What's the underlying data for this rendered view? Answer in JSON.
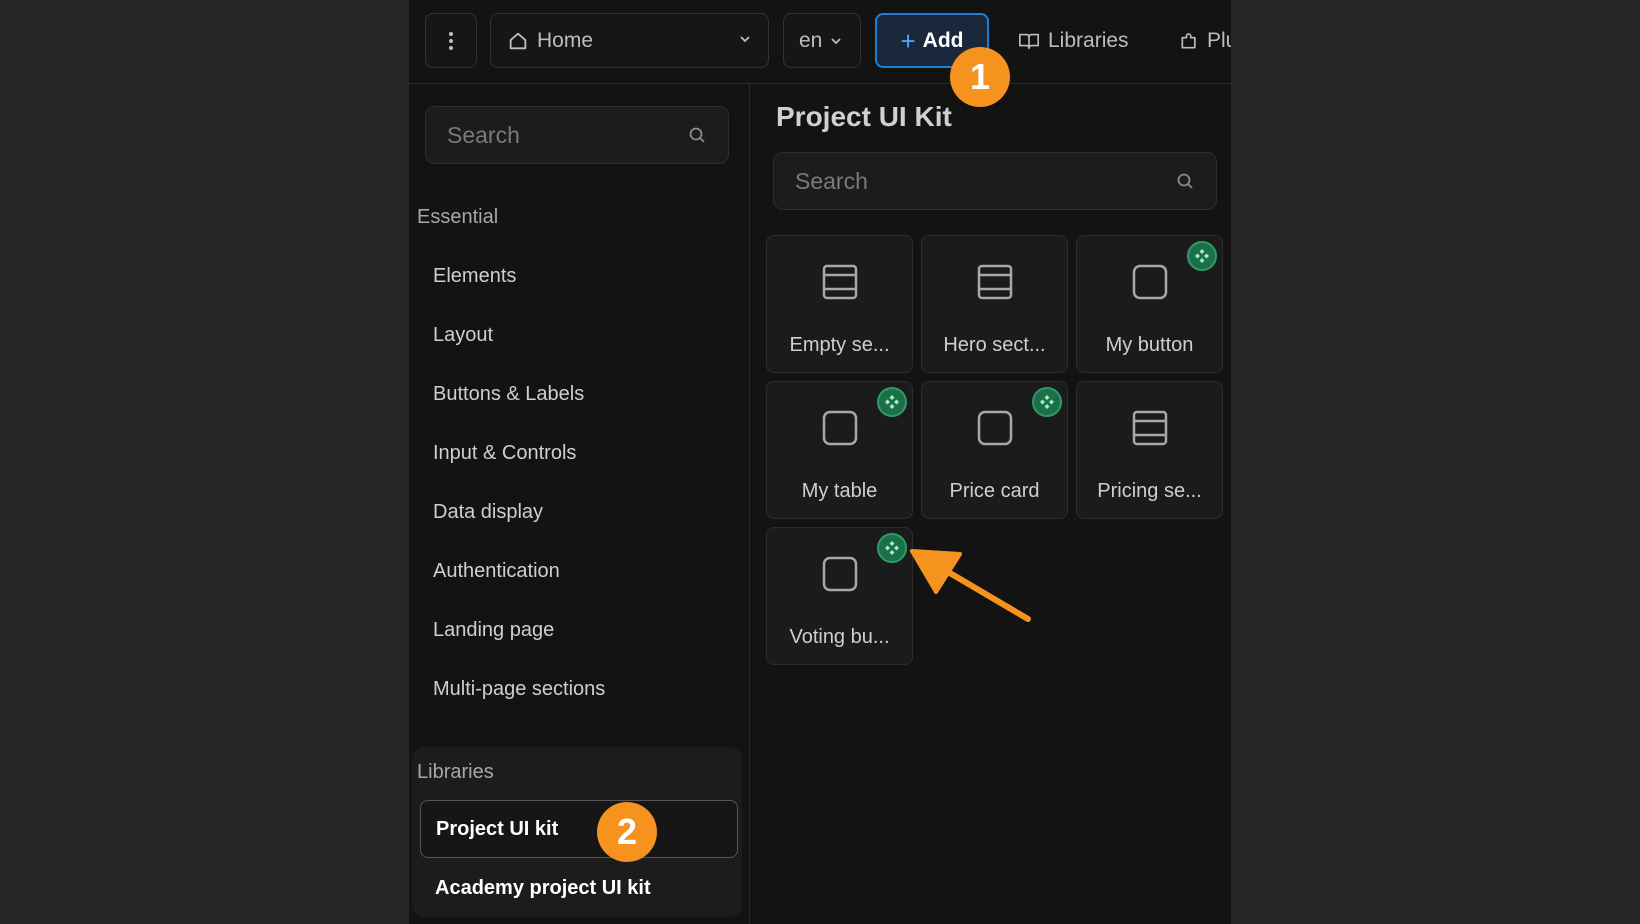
{
  "topbar": {
    "page_select": "Home",
    "language_select": "en",
    "add_label": "Add",
    "libraries_label": "Libraries",
    "plugins_label": "Plu"
  },
  "sidebar": {
    "search_placeholder": "Search",
    "essential_title": "Essential",
    "items": [
      {
        "label": "Elements"
      },
      {
        "label": "Layout"
      },
      {
        "label": "Buttons & Labels"
      },
      {
        "label": "Input & Controls"
      },
      {
        "label": "Data display"
      },
      {
        "label": "Authentication"
      },
      {
        "label": "Landing page"
      },
      {
        "label": "Multi-page sections"
      }
    ],
    "libraries_title": "Libraries",
    "libraries": [
      {
        "label": "Project UI kit",
        "active": true
      },
      {
        "label": "Academy project UI kit",
        "active": false
      }
    ]
  },
  "main": {
    "title": "Project UI Kit",
    "search_placeholder": "Search",
    "cards": [
      {
        "label": "Empty se...",
        "icon": "section-icon",
        "component": false
      },
      {
        "label": "Hero sect...",
        "icon": "section-icon",
        "component": false
      },
      {
        "label": "My button",
        "icon": "square-icon",
        "component": true
      },
      {
        "label": "My table",
        "icon": "square-icon",
        "component": true
      },
      {
        "label": "Price card",
        "icon": "square-icon",
        "component": true
      },
      {
        "label": "Pricing se...",
        "icon": "section-icon",
        "component": false
      },
      {
        "label": "Voting bu...",
        "icon": "square-icon",
        "component": true
      }
    ]
  },
  "annotations": {
    "step_1": "1",
    "step_2": "2",
    "accent_color": "#f6931f"
  },
  "colors": {
    "background": "#131313",
    "add_button_border": "#1f7fd6",
    "component_badge": "#1c6f48"
  }
}
